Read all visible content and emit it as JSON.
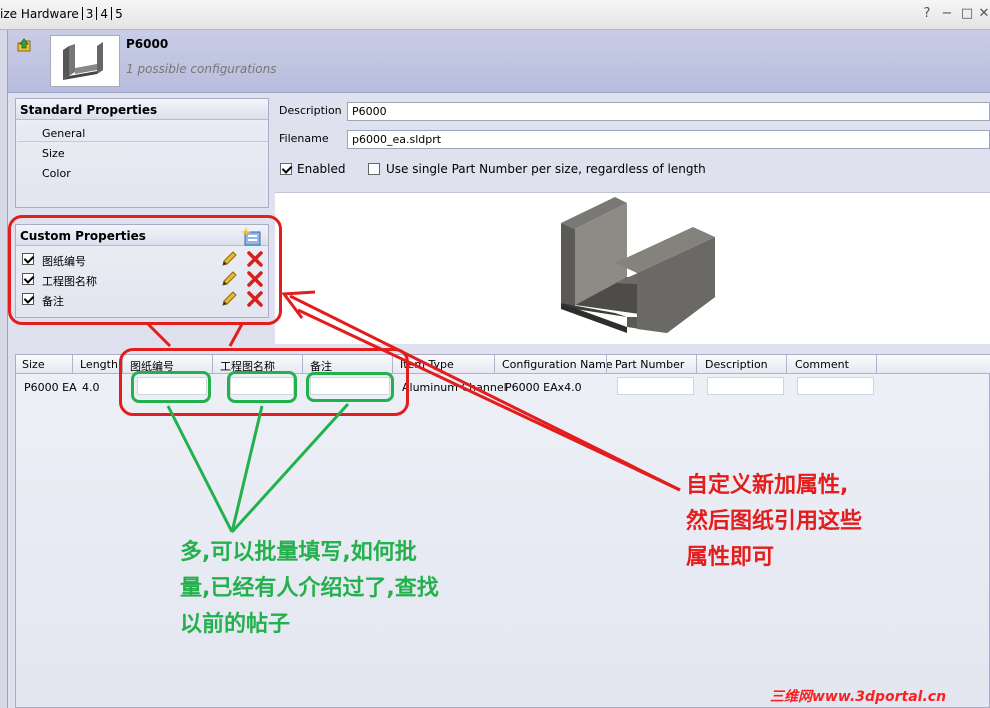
{
  "window": {
    "title": "ize Hardware",
    "tabs": [
      "3",
      "4",
      "5"
    ],
    "controls": [
      "?",
      "−",
      "□",
      "✕"
    ]
  },
  "part": {
    "name": "P6000",
    "configurations": "1 possible configurations"
  },
  "standard_properties": {
    "title": "Standard Properties",
    "items": [
      "General",
      "Size",
      "Color"
    ]
  },
  "custom_properties": {
    "title": "Custom Properties",
    "items": [
      {
        "label": "图纸编号",
        "checked": true
      },
      {
        "label": "工程图名称",
        "checked": true
      },
      {
        "label": "备注",
        "checked": true
      }
    ]
  },
  "form": {
    "description_label": "Description",
    "description_value": "P6000",
    "filename_label": "Filename",
    "filename_value": "p6000_ea.sldprt",
    "enabled_label": "Enabled",
    "enabled_checked": true,
    "single_part_label": "Use single Part Number per size, regardless of length",
    "single_part_checked": false
  },
  "grid": {
    "columns": [
      "Size",
      "Length",
      "图纸编号",
      "工程图名称",
      "备注",
      "Item Type",
      "Configuration Name",
      "Part Number",
      "Description",
      "Comment"
    ],
    "rows": [
      {
        "size": "P6000 EA",
        "length": "4.0",
        "item_type": "Aluminum Channel",
        "configuration": "P6000 EAx4.0"
      }
    ]
  },
  "annotations": {
    "red_note": [
      "自定义新加属性,",
      "然后图纸引用这些",
      "属性即可"
    ],
    "green_note": [
      "多,可以批量填写,如何批",
      "量,已经有人介绍过了,查找",
      "以前的帖子"
    ],
    "red_color": "#e31c1c",
    "green_color": "#22b14c"
  },
  "watermark": "三维网www.3dportal.cn"
}
